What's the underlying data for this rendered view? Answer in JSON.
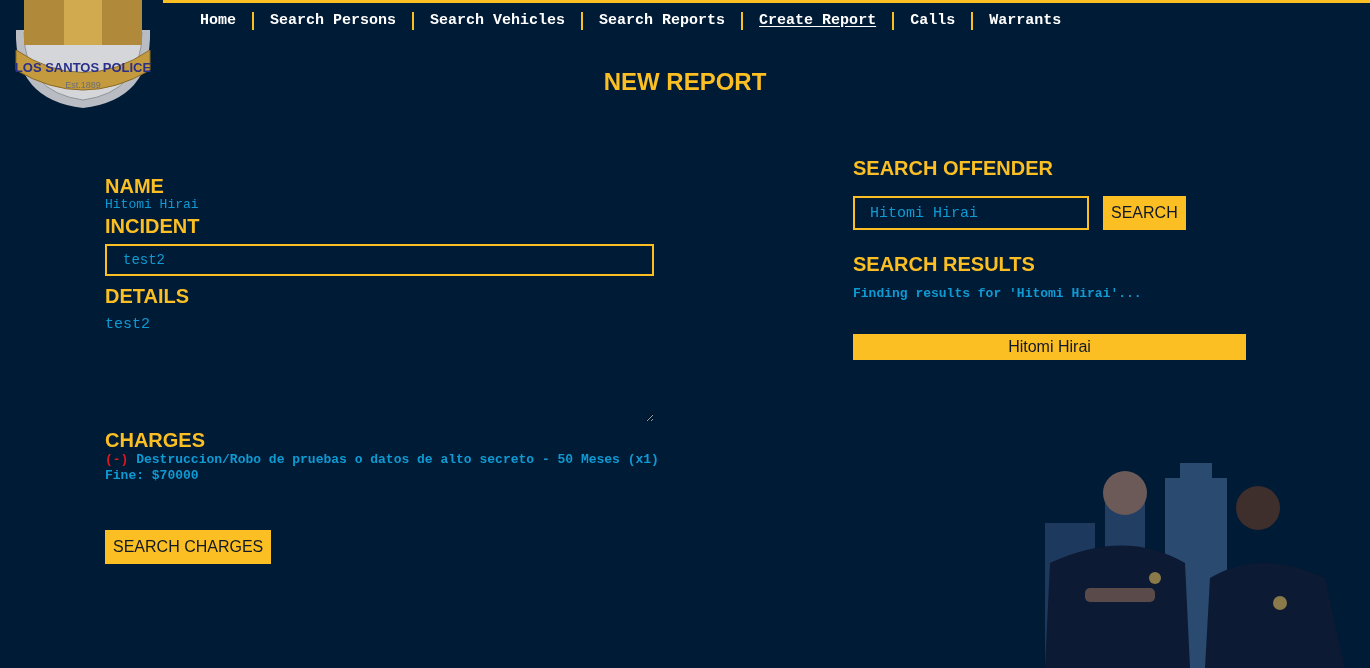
{
  "logo": {
    "name": "LOS SANTOS POLICE",
    "established": "Est.1889"
  },
  "nav": [
    {
      "label": "Home",
      "selected": false
    },
    {
      "label": "Search Persons",
      "selected": false
    },
    {
      "label": "Search Vehicles",
      "selected": false
    },
    {
      "label": "Search Reports",
      "selected": false
    },
    {
      "label": "Create Report",
      "selected": true
    },
    {
      "label": "Calls",
      "selected": false
    },
    {
      "label": "Warrants",
      "selected": false
    }
  ],
  "page_title": "NEW REPORT",
  "report": {
    "name_label": "NAME",
    "name_value": "Hitomi Hirai",
    "incident_label": "INCIDENT",
    "incident_value": "test2",
    "details_label": "DETAILS",
    "details_value": "test2",
    "charges_label": "CHARGES",
    "charges": [
      {
        "remove": "(-)",
        "text": "Destruccion/Robo de pruebas o datos de alto secreto - 50 Meses (x1)"
      }
    ],
    "fine": "Fine: $70000",
    "search_charges_button": "SEARCH CHARGES"
  },
  "offender_search": {
    "label": "SEARCH OFFENDER",
    "query": "Hitomi Hirai",
    "button": "SEARCH",
    "results_label": "SEARCH RESULTS",
    "status": "Finding results for 'Hitomi Hirai'...",
    "results": [
      "Hitomi Hirai"
    ]
  }
}
